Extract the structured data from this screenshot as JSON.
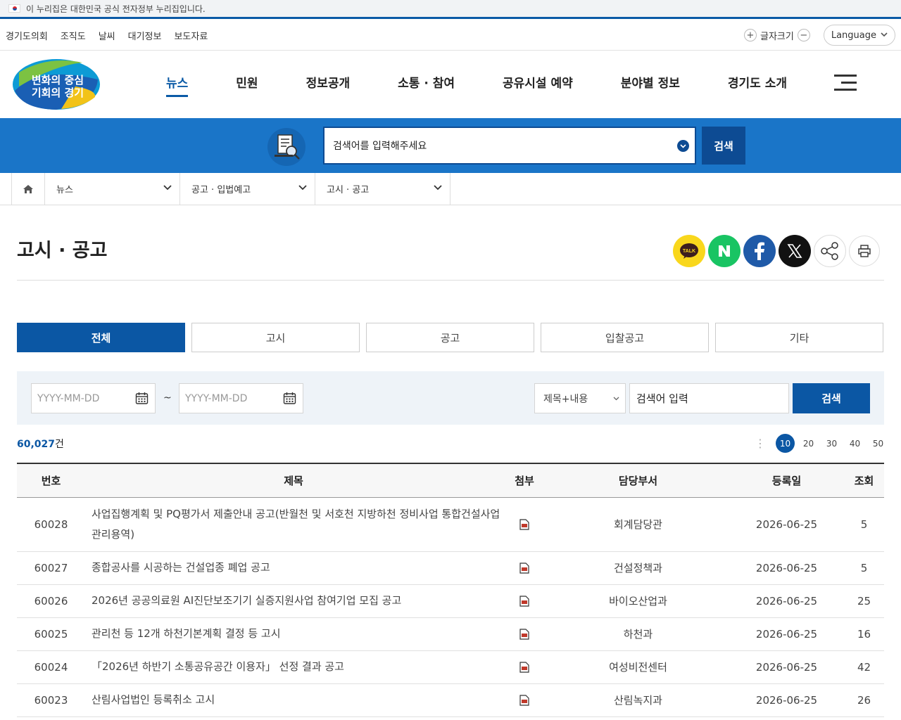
{
  "gov_banner": {
    "text": "이 누리집은 대한민국 공식 전자정부 누리집입니다."
  },
  "util": {
    "links": [
      "경기도의회",
      "조직도",
      "날씨",
      "대기정보",
      "보도자료"
    ],
    "font_size_label": "글자크기",
    "language_label": "Language"
  },
  "logo": {
    "text_line1": "변화의 중심",
    "text_line2": "기회의 경기"
  },
  "gnb": [
    "뉴스",
    "민원",
    "정보공개",
    "소통 · 참여",
    "공유시설 예약",
    "분야별 정보",
    "경기도 소개"
  ],
  "search_band": {
    "placeholder": "검색어를 입력해주세요",
    "button": "검색"
  },
  "breadcrumb": [
    "뉴스",
    "공고 · 입법예고",
    "고시 · 공고"
  ],
  "page_title": "고시 · 공고",
  "share_buttons": [
    "kakao-talk",
    "naver",
    "facebook",
    "x",
    "share",
    "print"
  ],
  "tabs": [
    "전체",
    "고시",
    "공고",
    "입찰공고",
    "기타"
  ],
  "filter": {
    "start_date_placeholder": "YYYY-MM-DD",
    "end_date_placeholder": "YYYY-MM-DD",
    "separator": "~",
    "select_value": "제목+내용",
    "keyword_value": "검색어 입력",
    "button": "검색"
  },
  "count": {
    "number": "60,027",
    "unit": "건"
  },
  "per_page": [
    "10",
    "20",
    "30",
    "40",
    "50"
  ],
  "table": {
    "headers": [
      "번호",
      "제목",
      "첨부",
      "담당부서",
      "등록일",
      "조회"
    ],
    "rows": [
      {
        "no": "60028",
        "title": "사업집행계획 및 PQ평가서 제출안내 공고(반월천 및 서호천 지방하천 정비사업 통합건설사업관리용역)",
        "dept": "회계담당관",
        "date": "2026-06-25",
        "views": "5"
      },
      {
        "no": "60027",
        "title": "종합공사를 시공하는 건설업종 폐업 공고",
        "dept": "건설정책과",
        "date": "2026-06-25",
        "views": "5"
      },
      {
        "no": "60026",
        "title": "2026년 공공의료원 AI진단보조기기 실증지원사업 참여기업 모집 공고",
        "dept": "바이오산업과",
        "date": "2026-06-25",
        "views": "25"
      },
      {
        "no": "60025",
        "title": "관리천 등 12개 하천기본계획 결정 등 고시",
        "dept": "하천과",
        "date": "2026-06-25",
        "views": "16"
      },
      {
        "no": "60024",
        "title": "「2026년 하반기 소통공유공간 이용자」 선정 결과 공고",
        "dept": "여성비전센터",
        "date": "2026-06-25",
        "views": "42"
      },
      {
        "no": "60023",
        "title": "산림사업법인 등록취소 고시",
        "dept": "산림녹지과",
        "date": "2026-06-25",
        "views": "26"
      }
    ]
  },
  "colors": {
    "primary": "#0b57a4",
    "band": "#1a75c8",
    "dark": "#0d4b93"
  }
}
